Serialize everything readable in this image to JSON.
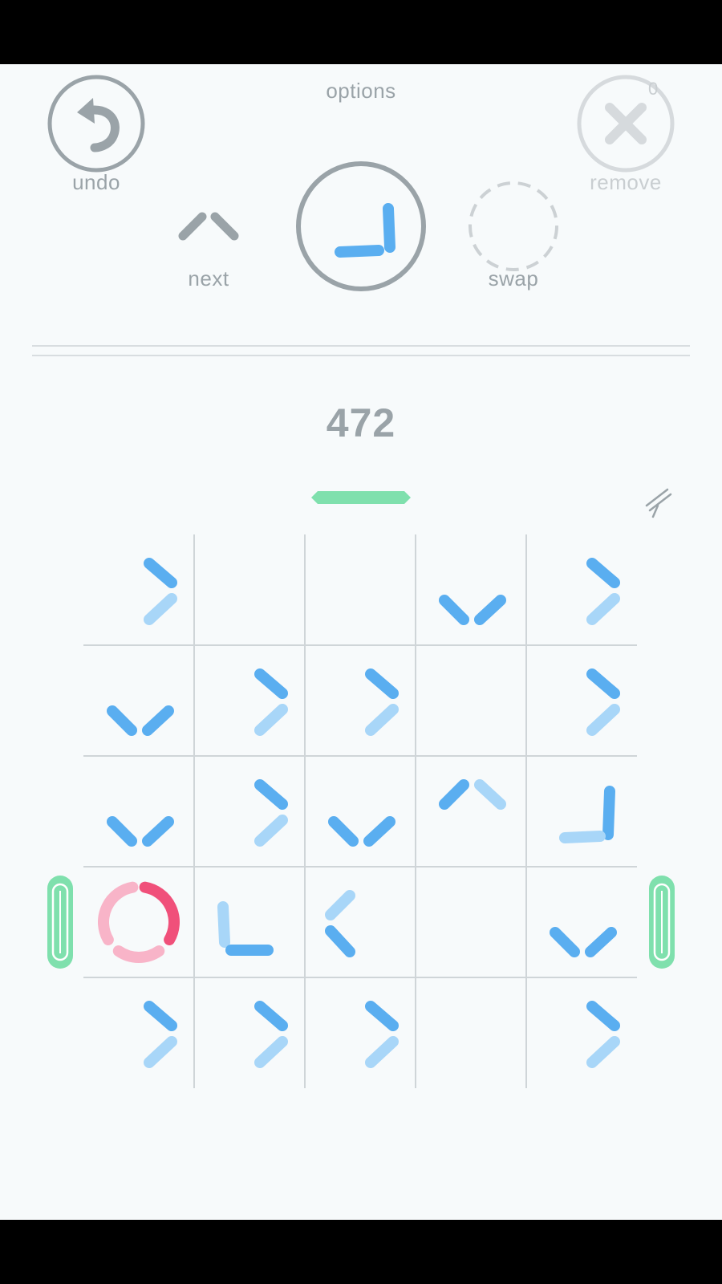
{
  "header": {
    "options_label": "options",
    "undo_label": "undo",
    "remove_label": "remove",
    "remove_count": "0",
    "next_label": "next",
    "swap_label": "swap"
  },
  "score": "472",
  "icons": {
    "undo": "undo-arrow-icon",
    "remove": "x-icon",
    "next": "chevron-up-icon",
    "settings": "pencil-icon"
  },
  "colors": {
    "background": "#f7fafb",
    "ui_gray": "#9aa3a8",
    "blue_dark": "#5aaef0",
    "blue_light": "#a8d6f8",
    "green": "#7fe0ad",
    "pink_dark": "#f0507a",
    "pink_light": "#f8b4c8"
  },
  "current_piece": {
    "shape": "corner-bottom-left",
    "color": "blue"
  },
  "board": {
    "rows": 5,
    "cols": 5,
    "cells": [
      [
        "chevron-right",
        "empty",
        "empty",
        "chevron-down",
        "chevron-right"
      ],
      [
        "chevron-down",
        "chevron-right",
        "chevron-right",
        "empty",
        "chevron-right"
      ],
      [
        "chevron-down",
        "chevron-right",
        "chevron-down",
        "chevron-up",
        "corner-bottom-left"
      ],
      [
        "target-ring",
        "corner-top-left",
        "chevron-left",
        "empty",
        "chevron-down"
      ],
      [
        "chevron-right",
        "chevron-right",
        "chevron-right",
        "empty",
        "chevron-right"
      ]
    ]
  }
}
